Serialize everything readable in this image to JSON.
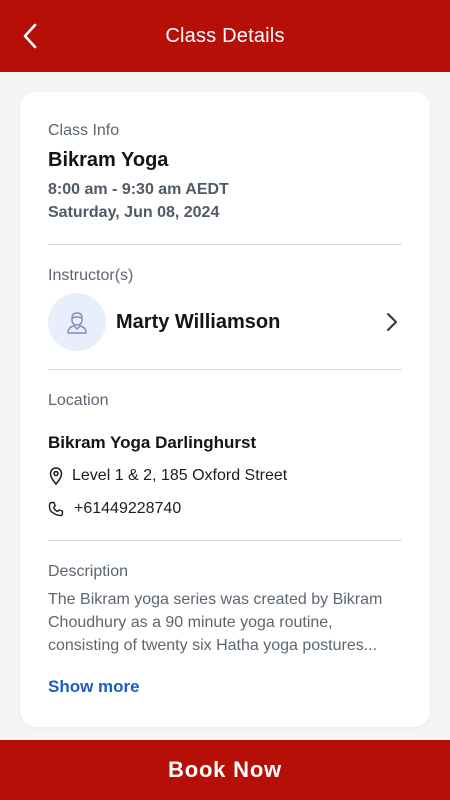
{
  "header": {
    "title": "Class Details"
  },
  "class_info": {
    "label": "Class Info",
    "name": "Bikram Yoga",
    "time": "8:00 am - 9:30 am AEDT",
    "date": "Saturday, Jun 08, 2024"
  },
  "instructor": {
    "label": "Instructor(s)",
    "name": "Marty Williamson"
  },
  "location": {
    "label": "Location",
    "name": "Bikram Yoga Darlinghurst",
    "address": "Level 1 & 2, 185 Oxford Street",
    "phone": "+61449228740"
  },
  "description": {
    "label": "Description",
    "text": "The Bikram yoga series was created by Bikram Choudhury as a 90 minute yoga routine, consisting of twenty six Hatha yoga postures...",
    "show_more": "Show more"
  },
  "footer": {
    "book_label": "Book Now"
  },
  "colors": {
    "brand": "#b60f07",
    "link": "#1a5cc8",
    "avatar_bg": "#e9eefc"
  },
  "icons": {
    "back": "chevron-left-icon",
    "instructor": "person-icon",
    "instructor_nav": "chevron-right-icon",
    "address": "map-pin-icon",
    "phone": "phone-icon"
  }
}
